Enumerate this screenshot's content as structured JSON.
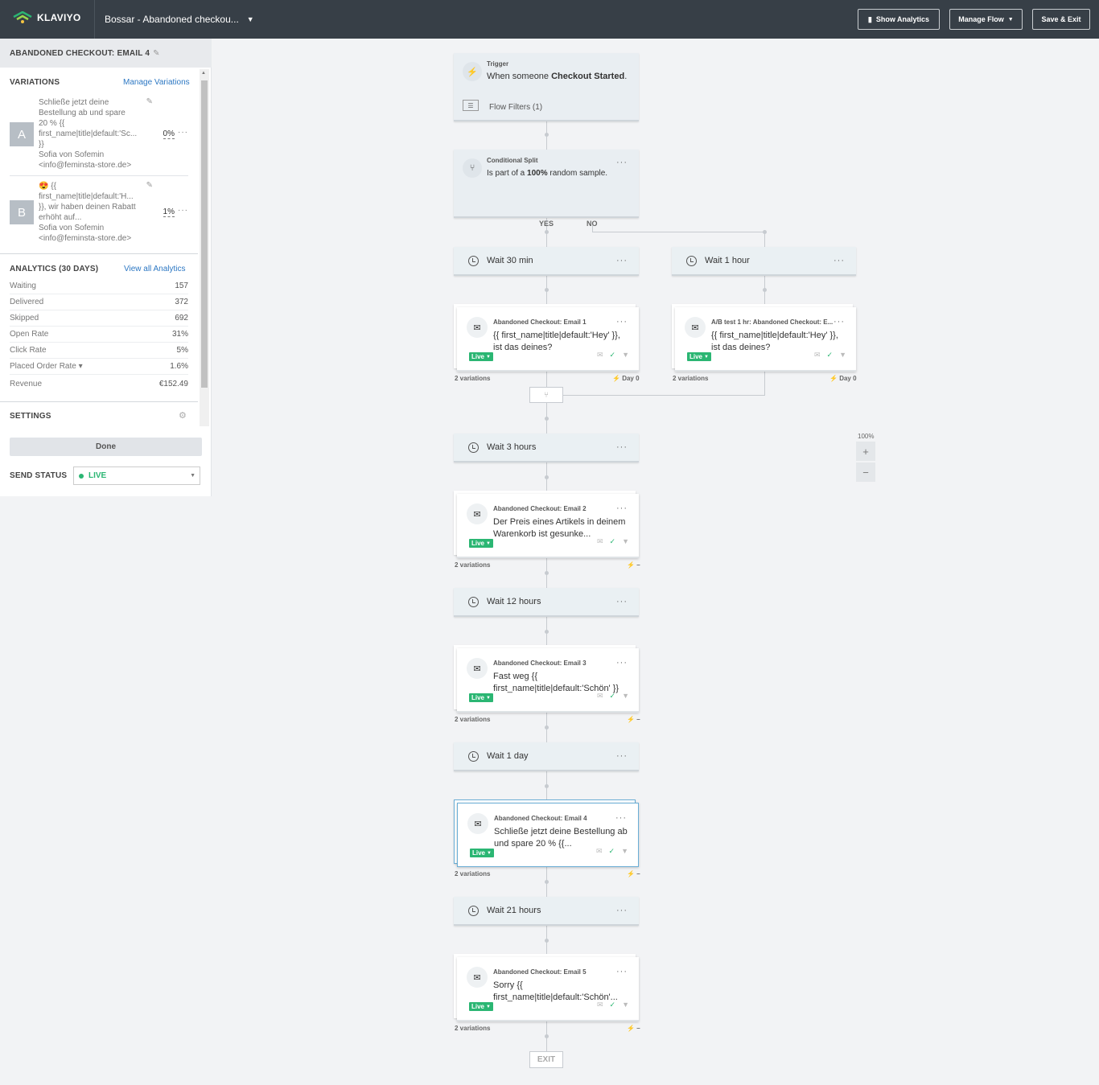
{
  "topbar": {
    "brand": "KLAVIYO",
    "flow_name": "Bossar - Abandoned checkou...",
    "show_analytics": "Show Analytics",
    "manage_flow": "Manage Flow",
    "save_exit": "Save & Exit"
  },
  "sidebar": {
    "title": "ABANDONED CHECKOUT: EMAIL 4",
    "variations_label": "VARIATIONS",
    "manage_variations": "Manage Variations",
    "variations": [
      {
        "badge": "A",
        "line1": "Schließe jetzt deine",
        "line2": "Bestellung ab und spare",
        "line3": "20 % {{",
        "line4": "first_name|title|default:'Sc...",
        "line5": "}}",
        "from": "Sofia von Sofemin",
        "email": "<info@feminsta-store.de>",
        "pct": "0%"
      },
      {
        "badge": "B",
        "line1": "😍 {{",
        "line2": "first_name|title|default:'H...",
        "line3": "}}, wir haben deinen Rabatt",
        "line4": "erhöht auf...",
        "from": "Sofia von Sofemin",
        "email": "<info@feminsta-store.de>",
        "pct": "1%"
      }
    ],
    "analytics_label": "ANALYTICS (30 DAYS)",
    "view_all": "View all Analytics",
    "stats": [
      {
        "label": "Waiting",
        "value": "157"
      },
      {
        "label": "Delivered",
        "value": "372"
      },
      {
        "label": "Skipped",
        "value": "692"
      },
      {
        "label": "Open Rate",
        "value": "31%"
      },
      {
        "label": "Click Rate",
        "value": "5%"
      },
      {
        "label": "Placed Order Rate ▾",
        "value": "1.6%"
      },
      {
        "label": "Revenue",
        "value": "€152.49"
      }
    ],
    "settings_label": "SETTINGS",
    "done": "Done",
    "send_status_label": "SEND STATUS",
    "send_status_value": "LIVE"
  },
  "canvas": {
    "trigger_label": "Trigger",
    "trigger_text_pre": "When someone ",
    "trigger_text_bold": "Checkout Started",
    "trigger_text_post": ".",
    "flow_filters": "Flow Filters (1)",
    "split_label": "Conditional Split",
    "split_text_pre": "Is part of a ",
    "split_text_bold": "100%",
    "split_text_post": " random sample.",
    "yes": "YES",
    "no": "NO",
    "wait_a": "Wait 30 min",
    "wait_b": "Wait 1 hour",
    "email1_title": "Abandoned Checkout: Email 1",
    "email1_sub": "{{ first_name|title|default:'Hey' }}, ist das deines?",
    "email_b_title": "A/B test 1 hr: Abandoned Checkout: E...",
    "email_b_sub": "{{ first_name|title|default:'Hey' }}, ist das deines?",
    "variations": "2 variations",
    "day0": "Day 0",
    "dash": "–",
    "live": "Live",
    "wait_3h": "Wait 3 hours",
    "email2_title": "Abandoned Checkout: Email 2",
    "email2_sub": "Der Preis eines Artikels in deinem Warenkorb ist gesunke...",
    "wait_12h": "Wait 12 hours",
    "email3_title": "Abandoned Checkout: Email 3",
    "email3_sub": "Fast weg {{ first_name|title|default:'Schön' }}",
    "wait_1d": "Wait 1 day",
    "email4_title": "Abandoned Checkout: Email 4",
    "email4_sub": "Schließe jetzt deine Bestellung ab und spare 20 % {{...",
    "wait_21h": "Wait 21 hours",
    "email5_title": "Abandoned Checkout: Email 5",
    "email5_sub": "Sorry {{ first_name|title|default:'Schön'...",
    "exit": "EXIT",
    "zoom": "100%"
  },
  "colors": {
    "topbar": "#373f47",
    "live": "#2bb673",
    "link": "#2c77c3",
    "brand": "#2bb673"
  }
}
